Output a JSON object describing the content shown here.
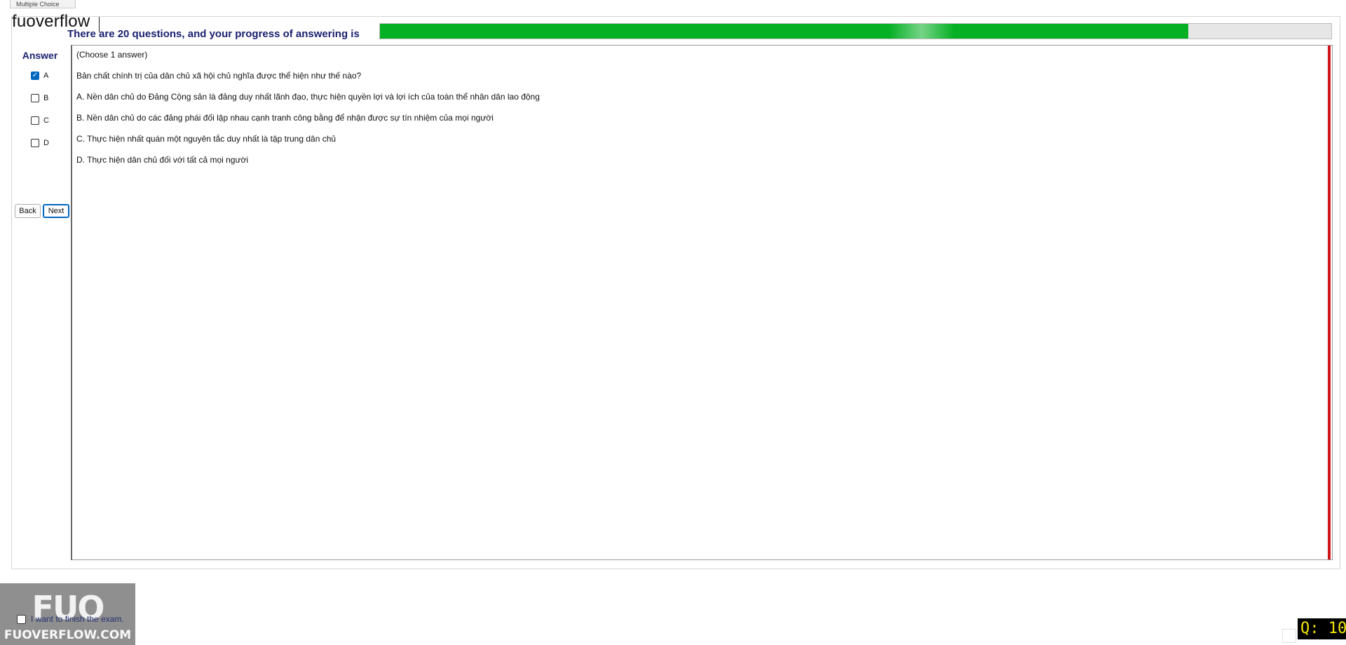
{
  "window": {
    "tab_label": "Multiple Choice"
  },
  "overlay": {
    "watermark": "fuoverflow"
  },
  "progress": {
    "label": "There are 20 questions, and your progress of answering is",
    "fraction": 0.85
  },
  "answer_panel": {
    "title": "Answer",
    "options": [
      {
        "label": "A",
        "checked": true
      },
      {
        "label": "B",
        "checked": false
      },
      {
        "label": "C",
        "checked": false
      },
      {
        "label": "D",
        "checked": false
      }
    ]
  },
  "nav": {
    "back_label": "Back",
    "next_label": "Next"
  },
  "question": {
    "instruction": "(Choose 1 answer)",
    "text": "Bản chất chính trị của dân chủ xã hội chủ nghĩa được thể hiện như thế nào?",
    "choices": [
      "A.  Nền dân chủ do Đảng Cộng sản là đảng duy nhất lãnh đạo, thực hiện quyền lợi và lợi ích của toàn thể nhân dân lao động",
      "B.  Nền dân chủ do các đảng phái đối lập nhau cạnh tranh công bằng để nhận được sự tín nhiệm của mọi người",
      "C.  Thực hiện nhất quán một nguyên tắc duy nhất là tập trung dân chủ",
      "D.  Thực hiện dân chủ đối với tất cả mọi người"
    ]
  },
  "footer": {
    "finish_label": "I want to finish the exam.",
    "finish_checked": false,
    "question_counter": "Q: 10"
  },
  "logo": {
    "mark": "FUO",
    "text": "FUOVERFLOW.COM"
  },
  "colors": {
    "progress_fill": "#06b025",
    "heading_navy": "#1a1f6e",
    "accent_red": "#d0141a",
    "counter_text": "#f2e600"
  }
}
